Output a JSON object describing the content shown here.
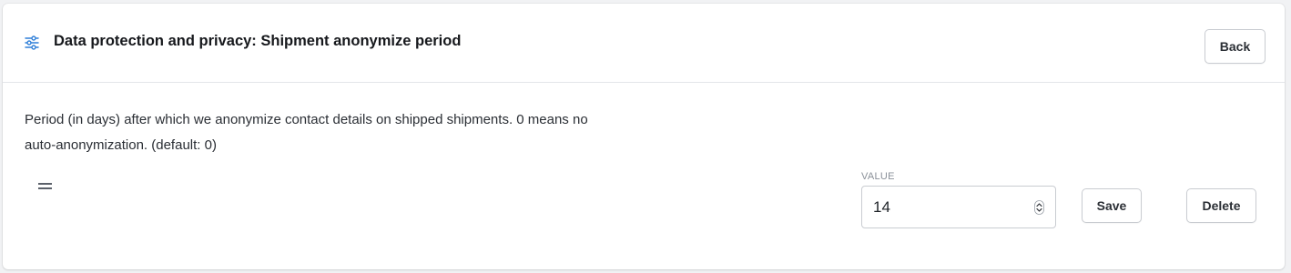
{
  "header": {
    "icon": "sliders-icon",
    "title": "Data protection and privacy: Shipment anonymize period",
    "back_label": "Back"
  },
  "setting": {
    "description": "Period (in days) after which we anonymize contact details on shipped shipments. 0 means no auto-anonymization. (default: 0)",
    "value_label": "VALUE",
    "value": "14",
    "save_label": "Save",
    "delete_label": "Delete"
  },
  "colors": {
    "accent_icon": "#2f7fd8",
    "border": "#c9ccd1",
    "divider": "#e4e6ea"
  }
}
